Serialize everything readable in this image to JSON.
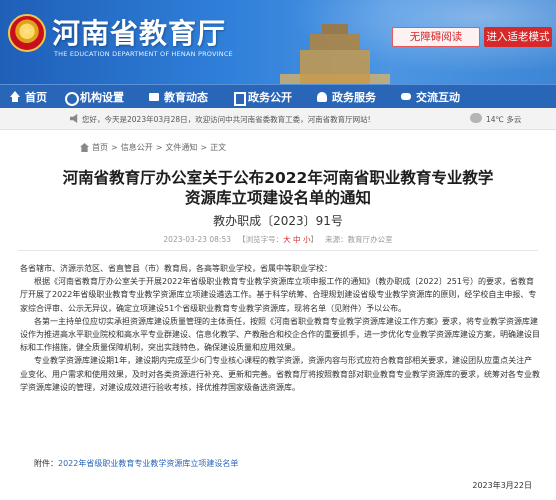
{
  "header": {
    "site_title": "河南省教育厅",
    "site_title_en": "THE EDUCATION DEPARTMENT OF HENAN PROVINCE",
    "accessible_label": "无障碍阅读",
    "elder_label": "进入适老模式",
    "brand_color": "#2a66b8",
    "accent_color": "#d7282a"
  },
  "nav": {
    "items": [
      {
        "label": "首页",
        "icon": "home-icon"
      },
      {
        "label": "机构设置",
        "icon": "org-icon"
      },
      {
        "label": "教育动态",
        "icon": "news-icon"
      },
      {
        "label": "政务公开",
        "icon": "gov-icon"
      },
      {
        "label": "政务服务",
        "icon": "service-icon"
      },
      {
        "label": "交流互动",
        "icon": "chat-icon"
      }
    ]
  },
  "notice": {
    "message": "您好，今天是2023年03月28日，欢迎访问中共河南省委教育工委，河南省教育厅网站!",
    "weather": "14℃ 多云"
  },
  "breadcrumb": [
    "首页",
    "信息公开",
    "文件通知",
    "正文"
  ],
  "article": {
    "title_line1": "河南省教育厅办公室关于公布2022年河南省职业教育专业教学",
    "title_line2": "资源库立项建设名单的通知",
    "doc_number": "教办职成〔2023〕91号",
    "date_time": "2023-03-23 08:53",
    "font_label_prefix": "【浏览字号：",
    "font_sizes": [
      "大",
      "中",
      "小"
    ],
    "font_label_suffix": "】",
    "source": "来源：教育厅办公室",
    "greeting": "各省辖市、济源示范区、省直管县（市）教育局，各高等职业学校，省属中等职业学校：",
    "paragraphs": [
      "根据《河南省教育厅办公室关于开展2022年省级职业教育专业教学资源库立项申报工作的通知》（教办职成〔2022〕251号）的要求，省教育厅开展了2022年省级职业教育专业教学资源库立项建设遴选工作。基于科学统筹、合理规划建设省级专业教学资源库的原则，经学校自主申报、专家综合评审、公示无异议，确定立项建设51个省级职业教育专业教学资源库，现将名单（见附件）予以公布。",
      "各第一主持单位应切实承担资源库建设质量管理的主体责任，按照《河南省职业教育专业教学资源库建设工作方案》要求，将专业教学资源库建设作为推进高水平职业院校和高水平专业群建设、信息化教学、产教融合和校企合作的重要抓手，进一步优化专业教学资源库建设方案，明确建设目标和工作措施，健全质量保障机制，突出实践特色，确保建设质量和应用效果。",
      "专业教学资源库建设期1年，建设期内完成至少6门专业核心课程的教学资源，资源内容与形式应符合教育部相关要求，建设团队应重点关注产业变化、用户需求和使用效果，及时对各类资源进行补充、更新和完善。省教育厅将按照教育部对职业教育专业教学资源库的要求，统筹对各专业教学资源库建设的管理，对建设成效进行验收考核，择优推荐国家级备选资源库。"
    ],
    "attachment_prefix": "附件：",
    "attachment_link": "2022年省级职业教育专业教学资源库立项建设名单",
    "sign_date": "2023年3月22日"
  }
}
